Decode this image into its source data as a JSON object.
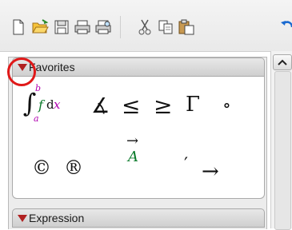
{
  "toolbar": {
    "icons": [
      "new-document-icon",
      "open-folder-icon",
      "save-icon",
      "print-icon",
      "print-preview-icon",
      "cut-icon",
      "copy-icon",
      "paste-icon",
      "undo-icon"
    ]
  },
  "panels": {
    "favorites": {
      "label": "Favorites",
      "symbols": {
        "integral_lower": "a",
        "integral_upper": "b",
        "integral_f": "f",
        "integral_d": "d",
        "integral_x": "x",
        "measured_angle": "∡",
        "less_equal": "≤",
        "greater_equal": "≥",
        "gamma": "Γ",
        "degree": "∘",
        "copyright": "©",
        "registered": "®",
        "vector_arrow": "→",
        "vector_letter": "A",
        "prime": "′",
        "right_arrow": "→"
      }
    },
    "expression": {
      "label": "Expression"
    }
  },
  "colors": {
    "highlight": "#e01818",
    "arrow": "#b02020",
    "integral_limits": "#b000b0",
    "integral_x": "#b000b0",
    "vector": "#0a7a2a"
  }
}
